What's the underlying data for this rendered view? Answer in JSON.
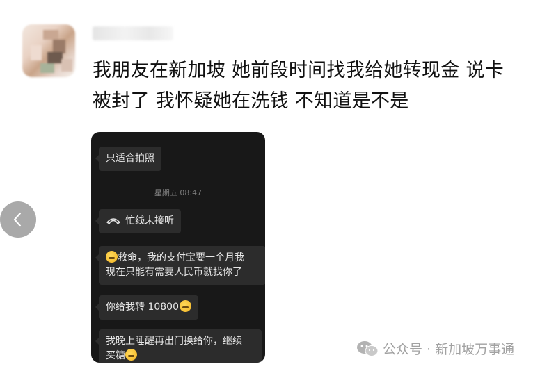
{
  "author": {
    "name": "—"
  },
  "post": {
    "line1": "我朋友在新加坡 她前段时间找我给她转现金 说卡",
    "line2": "被封了 我怀疑她在洗钱 不知道是不是"
  },
  "chat": {
    "messages": [
      {
        "text": "只适合拍照"
      },
      {
        "timestamp": "星期五 08:47"
      },
      {
        "text": "忙线未接听",
        "icon": "declined-call-icon"
      },
      {
        "line1": "救命，我的支付宝要一个月我",
        "line2": "现在只能有需要人民币就找你了",
        "emoji": "emoji-icon"
      },
      {
        "text": "你给我转 10800",
        "emoji": "emoji-icon"
      },
      {
        "line1": "我晚上睡醒再出门换给你，继续",
        "line2": "买糖",
        "emoji": "emoji-icon"
      }
    ]
  },
  "nav": {
    "back_icon": "chevron-left-icon"
  },
  "watermark": {
    "icon": "wechat-icon",
    "text": "公众号 · 新加坡万事通"
  },
  "colors": {
    "chat_background": "#181818",
    "bubble": "#2c2c2c",
    "bubble_text": "#e6e6e6",
    "back_button": "#a9a9a9",
    "watermark_text": "#a2a2a2"
  }
}
